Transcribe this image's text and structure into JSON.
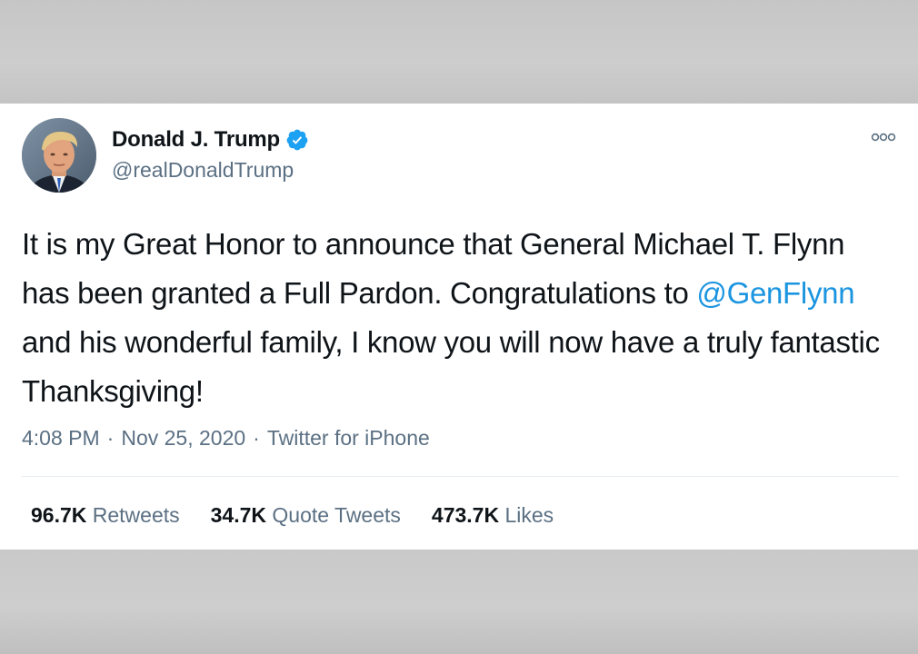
{
  "tweet": {
    "display_name": "Donald J. Trump",
    "handle": "@realDonaldTrump",
    "text_before": "It is my Great Honor to announce that General Michael T. Flynn has been granted a Full Pardon. Congratulations to ",
    "mention": "@GenFlynn",
    "text_after": " and his wonderful family, I know you will now have a truly fantastic Thanksgiving!",
    "time": "4:08 PM",
    "separator": "·",
    "date": "Nov 25, 2020",
    "source": "Twitter for iPhone",
    "stats": [
      {
        "count": "96.7K",
        "label": "Retweets"
      },
      {
        "count": "34.7K",
        "label": "Quote Tweets"
      },
      {
        "count": "473.7K",
        "label": "Likes"
      }
    ],
    "icons": {
      "verified": "verified-badge-icon",
      "more": "more-options-icon"
    },
    "colors": {
      "link": "#1b95e0",
      "verified": "#1da1f2",
      "secondary_text": "#5b7083",
      "primary_text": "#0f1419"
    }
  }
}
